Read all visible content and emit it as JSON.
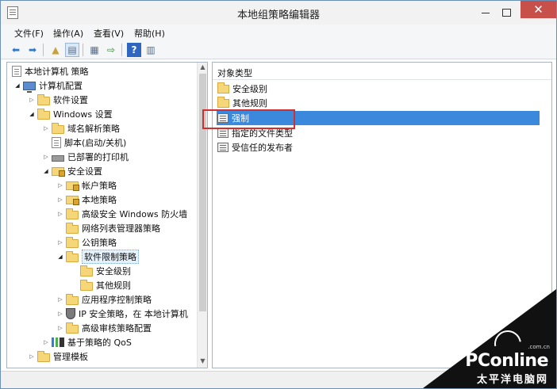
{
  "window": {
    "title": "本地组策略编辑器",
    "close_glyph": "✕"
  },
  "menubar": {
    "items": [
      {
        "label": "文件(F)"
      },
      {
        "label": "操作(A)"
      },
      {
        "label": "查看(V)"
      },
      {
        "label": "帮助(H)"
      }
    ]
  },
  "toolbar": {
    "icons": [
      {
        "name": "back-arrow-icon",
        "glyph": "⬅"
      },
      {
        "name": "forward-arrow-icon",
        "glyph": "➡"
      },
      {
        "name": "up-folder-icon",
        "glyph": "▲"
      },
      {
        "name": "show-hide-tree-icon",
        "glyph": "▤"
      },
      {
        "name": "properties-icon",
        "glyph": "▦"
      },
      {
        "name": "export-list-icon",
        "glyph": "⇨"
      },
      {
        "name": "help-icon",
        "glyph": "?"
      },
      {
        "name": "view-icon",
        "glyph": "▥"
      }
    ]
  },
  "tree": {
    "root": "本地计算机 策略",
    "computer_config": "计算机配置",
    "software_settings": "软件设置",
    "windows_settings": "Windows 设置",
    "dns_policy": "域名解析策略",
    "scripts": "脚本(启动/关机)",
    "deployed_printers": "已部署的打印机",
    "security_settings": "安全设置",
    "account_policy": "帐户策略",
    "local_policy": "本地策略",
    "firewall": "高级安全 Windows 防火墙",
    "network_list": "网络列表管理器策略",
    "public_key": "公钥策略",
    "software_restriction": "软件限制策略",
    "security_levels": "安全级别",
    "additional_rules": "其他规则",
    "app_control": "应用程序控制策略",
    "ip_security": "IP 安全策略，在 本地计算机",
    "audit_config": "高级审核策略配置",
    "qos": "基于策略的 QoS",
    "admin_templates": "管理模板",
    "twisty_open": "◢",
    "twisty_closed": "▷"
  },
  "list": {
    "column_header": "对象类型",
    "items": [
      {
        "label": "安全级别",
        "type": "folder"
      },
      {
        "label": "其他规则",
        "type": "folder"
      },
      {
        "label": "强制",
        "type": "policy",
        "selected": true
      },
      {
        "label": "指定的文件类型",
        "type": "policy"
      },
      {
        "label": "受信任的发布者",
        "type": "policy"
      }
    ]
  },
  "watermark": {
    "logo": "PConline",
    "domain": ".com.cn",
    "chinese": "太平洋电脑网"
  },
  "scrollbar": {
    "up_glyph": "▲",
    "down_glyph": "▼"
  }
}
